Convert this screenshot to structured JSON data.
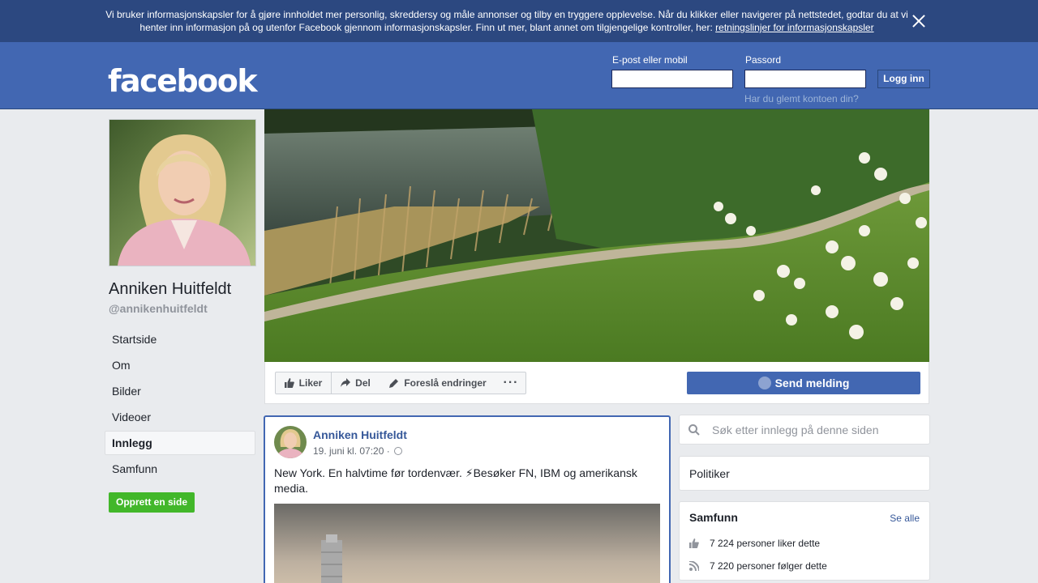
{
  "cookie_banner": {
    "text": "Vi bruker informasjonskapsler for å gjøre innholdet mer personlig, skreddersy og måle annonser og tilby en tryggere opplevelse. Når du klikker eller navigerer på nettstedet, godtar du at vi henter inn informasjon på og utenfor Facebook gjennom informasjonskapsler. Finn ut mer, blant annet om tilgjengelige kontroller, her: ",
    "link": "retningslinjer for informasjonskapsler"
  },
  "header": {
    "logo": "facebook",
    "email_label": "E-post eller mobil",
    "password_label": "Passord",
    "login_button": "Logg inn",
    "forgot_link": "Har du glemt kontoen din?"
  },
  "profile": {
    "name": "Anniken Huitfeldt",
    "handle": "@annikenhuitfeldt"
  },
  "nav": {
    "items": [
      {
        "label": "Startside"
      },
      {
        "label": "Om"
      },
      {
        "label": "Bilder"
      },
      {
        "label": "Videoer"
      },
      {
        "label": "Innlegg"
      },
      {
        "label": "Samfunn"
      }
    ],
    "active": "Innlegg",
    "create_page": "Opprett en side"
  },
  "actions": {
    "like": "Liker",
    "share": "Del",
    "suggest": "Foreslå endringer",
    "more": "···",
    "send_message": "Send melding"
  },
  "post": {
    "author": "Anniken Huitfeldt",
    "time": "19. juni kl. 07:20 ·",
    "text": "New York. En halvtime før tordenvær. ⚡Besøker FN, IBM og amerikansk media."
  },
  "sidebar": {
    "search_placeholder": "Søk etter innlegg på denne siden",
    "category": "Politiker",
    "community_title": "Samfunn",
    "see_all": "Se alle",
    "likes": "7 224 personer liker dette",
    "follows": "7 220 personer følger dette"
  },
  "colors": {
    "brand": "#4267b2",
    "banner": "#2c4880",
    "link": "#365899",
    "create_button": "#42b72a"
  }
}
